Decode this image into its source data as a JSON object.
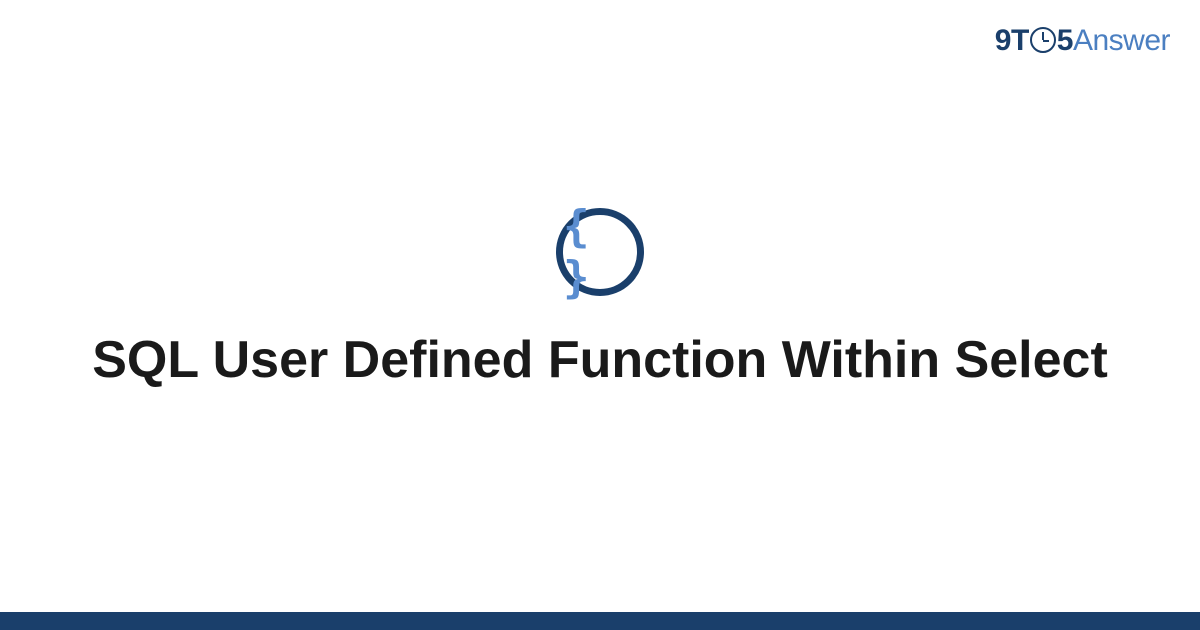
{
  "logo": {
    "nine": "9",
    "t": "T",
    "five": "5",
    "answer": "Answer"
  },
  "icon": {
    "braces": "{ }"
  },
  "title": "SQL User Defined Function Within Select"
}
